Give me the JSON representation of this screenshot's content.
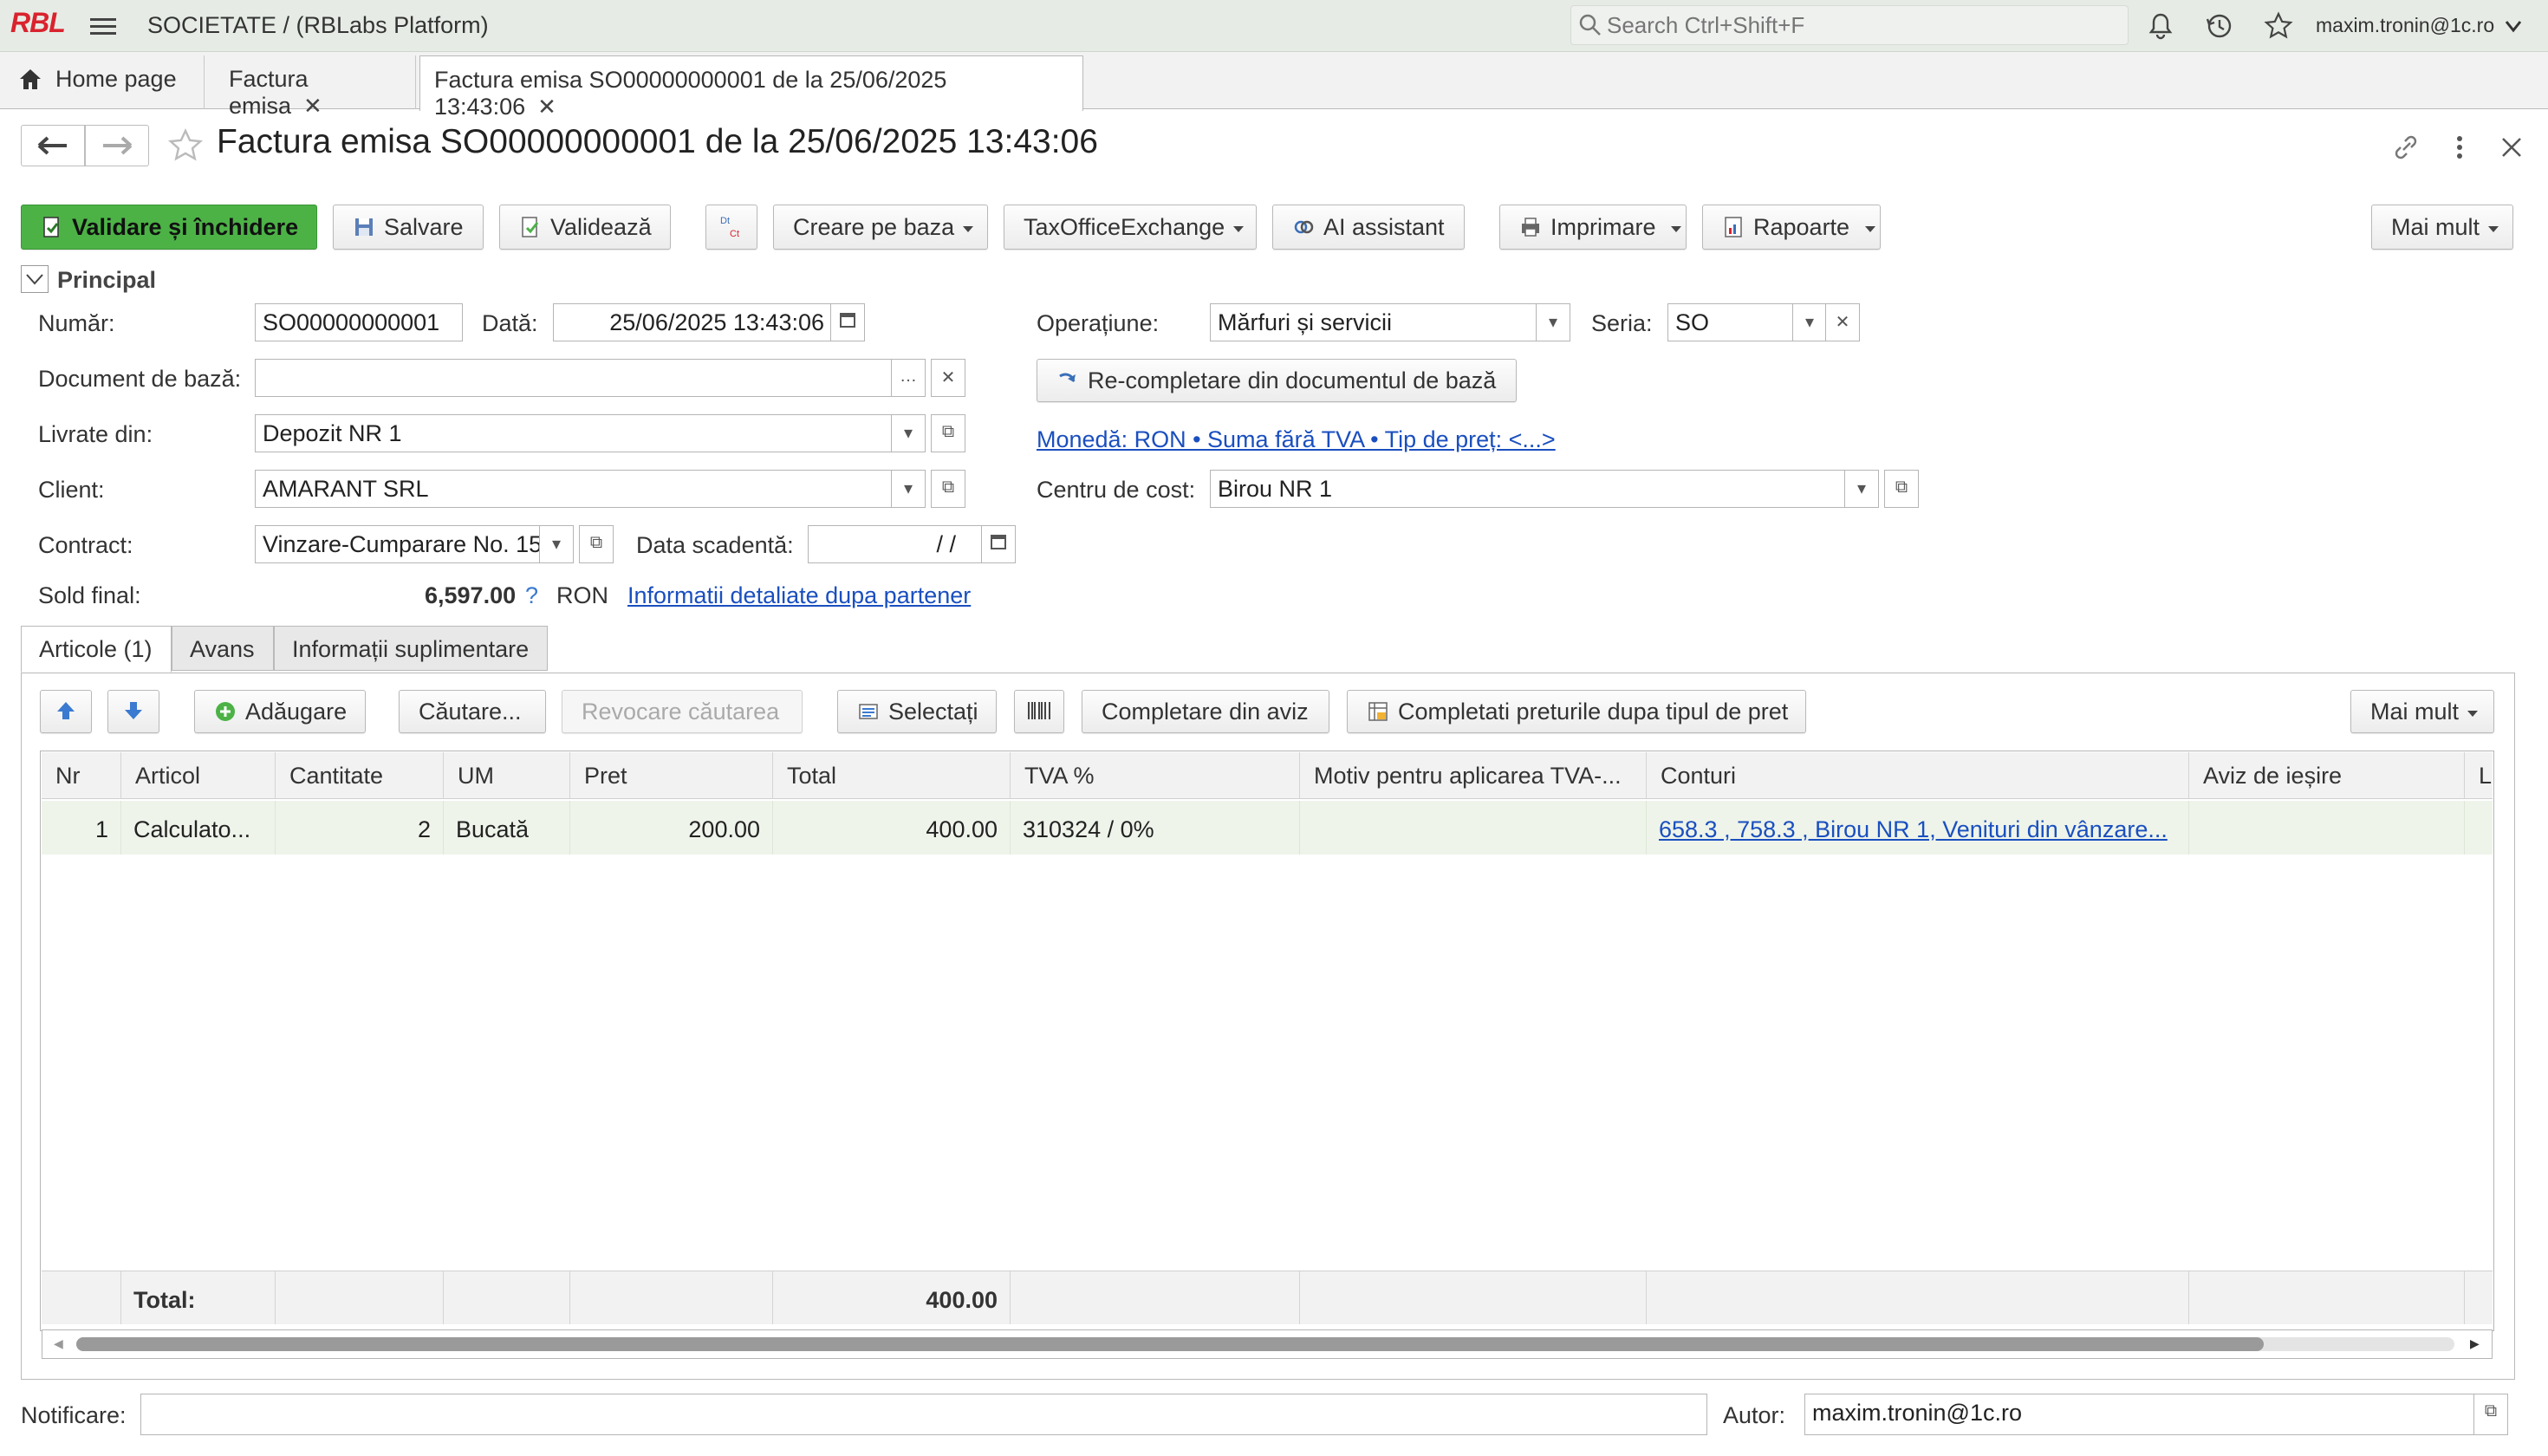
{
  "topbar": {
    "logo": "RBL",
    "company": "SOCIETATE /  (RBLabs Platform)",
    "search_placeholder": "Search Ctrl+Shift+F",
    "user": "maxim.tronin@1c.ro"
  },
  "tabs": [
    {
      "label": "Home page"
    },
    {
      "label": "Factura emisa"
    },
    {
      "label": "Factura emisa SO00000000001 de la 25/06/2025 13:43:06"
    }
  ],
  "page_title": "Factura emisa SO00000000001 de la 25/06/2025 13:43:06",
  "toolbar": {
    "validate_close": "Validare și închidere",
    "save": "Salvare",
    "validate": "Validează",
    "create_based": "Creare pe baza",
    "taxoffice": "TaxOfficeExchange",
    "ai_assistant": "AI assistant",
    "print": "Imprimare",
    "reports": "Rapoarte",
    "more": "Mai mult"
  },
  "group_label": "Principal",
  "form": {
    "number_label": "Număr:",
    "number_value": "SO00000000001",
    "date_label": "Dată:",
    "date_value": "25/06/2025 13:43:06",
    "operation_label": "Operațiune:",
    "operation_value": "Mărfuri și servicii",
    "series_label": "Seria:",
    "series_value": "SO",
    "base_doc_label": "Document de bază:",
    "base_doc_value": "",
    "refill_button": "Re-completare din documentul de bază",
    "delivered_label": "Livrate din:",
    "delivered_value": "Depozit NR 1",
    "currency_link": "Monedă: RON • Suma fără TVA • Tip de preț: <...>",
    "client_label": "Client:",
    "client_value": "AMARANT SRL",
    "cost_center_label": "Centru de cost:",
    "cost_center_value": "Birou NR 1",
    "contract_label": "Contract:",
    "contract_value": "Vinzare-Cumparare No. 15",
    "due_date_label": "Data scadentă:",
    "due_date_value": "/  /",
    "balance_label": "Sold final:",
    "balance_value": "6,597.00",
    "balance_help": "?",
    "balance_currency": "RON",
    "partner_link": "Informatii detaliate dupa partener"
  },
  "content_tabs": [
    "Articole (1)",
    "Avans",
    "Informații suplimentare"
  ],
  "grid_toolbar": {
    "add": "Adăugare",
    "search": "Căutare...",
    "cancel_search": "Revocare căutarea",
    "select": "Selectați",
    "fill_from_notice": "Completare din aviz",
    "fill_prices": "Completati preturile dupa tipul de pret",
    "more": "Mai mult"
  },
  "grid": {
    "columns": [
      "Nr",
      "Articol",
      "Cantitate",
      "UM",
      "Pret",
      "Total",
      "TVA %",
      "Motiv pentru aplicarea TVA-...",
      "Conturi",
      "Aviz de ieșire",
      "Li"
    ],
    "rows": [
      {
        "nr": "1",
        "articol": "Calculato...",
        "cantitate": "2",
        "um": "Bucată",
        "pret": "200.00",
        "total": "400.00",
        "tva": "310324 / 0%",
        "motiv": "",
        "conturi": "658.3 , 758.3 , Birou NR 1, Venituri din vânzare...",
        "aviz": ""
      }
    ],
    "footer_label": "Total:",
    "footer_total": "400.00"
  },
  "bottom": {
    "notification_label": "Notificare:",
    "notification_value": "",
    "author_label": "Autor:",
    "author_value": "maxim.tronin@1c.ro"
  },
  "colors": {
    "accent_green": "#4cb246",
    "topbar": "#e6ece5",
    "link": "#1a4fbf",
    "row_selected": "#eef4ea"
  }
}
